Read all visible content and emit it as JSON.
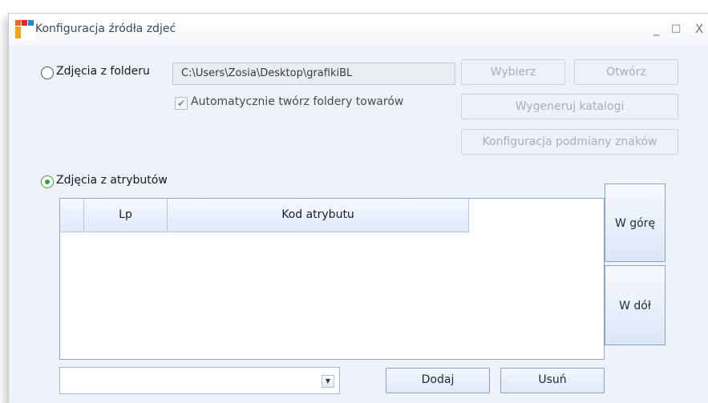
{
  "window": {
    "title": "Konfiguracja źródła zdjeć",
    "minimize": "_",
    "maximize": "□",
    "close": "X"
  },
  "folder_option": {
    "label": "Zdjęcia z folderu",
    "selected": false,
    "path": "C:\\Users\\Zosia\\Desktop\\grafikiBL",
    "auto_create_label": "Automatycznie twórz foldery towarów",
    "auto_create_checked": true,
    "buttons": {
      "choose": "Wybierz",
      "open": "Otwórz",
      "generate": "Wygeneruj katalogi",
      "char_config": "Konfiguracja podmiany znaków"
    }
  },
  "attribute_option": {
    "label": "Zdjęcia z atrybutów",
    "selected": true
  },
  "grid": {
    "columns": [
      "",
      "Lp",
      "Kod atrybutu"
    ],
    "rows": []
  },
  "side_buttons": {
    "up": "W górę",
    "down": "W dół"
  },
  "bottom": {
    "combo_value": "",
    "add": "Dodaj",
    "remove": "Usuń"
  },
  "icons": {
    "app": "app-logo-icon",
    "checkmark": "check-icon",
    "dropdown": "dropdown-arrow-icon"
  }
}
